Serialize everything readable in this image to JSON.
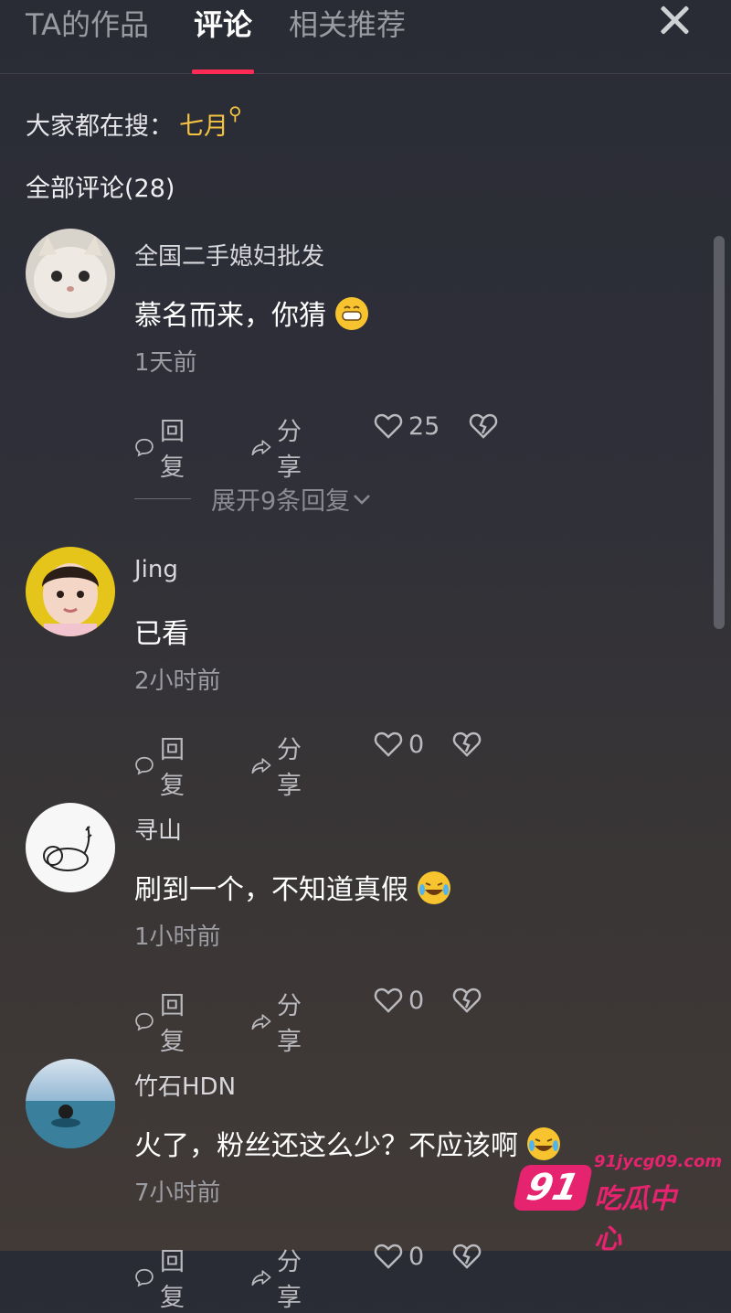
{
  "tabs": {
    "works": "TA的作品",
    "comments": "评论",
    "recommend": "相关推荐"
  },
  "search": {
    "prefix": "大家都在搜：",
    "keyword": "七月"
  },
  "comment_count_label": "全部评论(28)",
  "comments": [
    {
      "name": "全国二手媳妇批发",
      "text": "慕名而来，你猜",
      "emoji": "grinning-emoji",
      "time": "1天前",
      "reply": "回复",
      "share": "分享",
      "likes": "25",
      "expand": "展开9条回复"
    },
    {
      "name": "Jing",
      "text": "已看",
      "time": "2小时前",
      "reply": "回复",
      "share": "分享",
      "likes": "0"
    },
    {
      "name": "寻山",
      "text": "刷到一个，不知道真假",
      "emoji": "laughing-tears-emoji",
      "time": "1小时前",
      "reply": "回复",
      "share": "分享",
      "likes": "0"
    },
    {
      "name": "竹石HDN",
      "text": "火了，粉丝还这么少？不应该啊",
      "emoji": "laughing-tears-emoji",
      "time": "7小时前",
      "reply": "回复",
      "share": "分享",
      "likes": "0"
    }
  ],
  "watermark": {
    "badge": "91",
    "url": "91jycg09.com",
    "name": "吃瓜中心"
  },
  "colors": {
    "accent": "#fe2c55",
    "keyword": "#f5c242",
    "watermark": "#e5236e"
  }
}
